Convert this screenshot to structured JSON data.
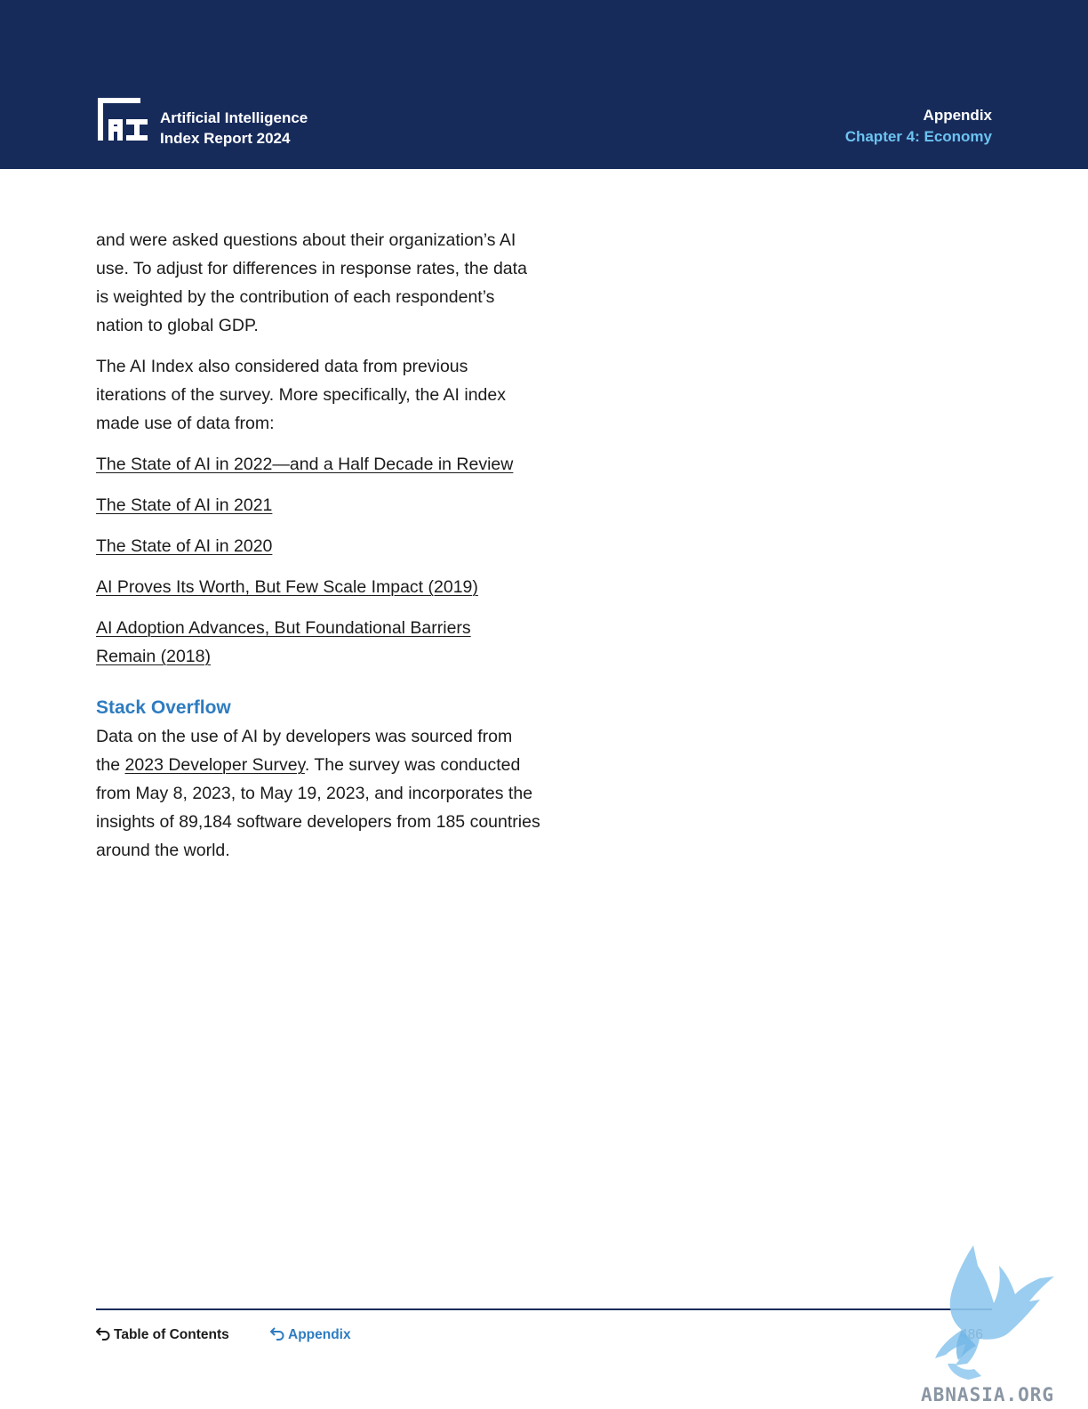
{
  "header": {
    "brand_line1": "Artificial Intelligence",
    "brand_line2": "Index Report 2024",
    "logo_text": "AI",
    "section": "Appendix",
    "chapter": "Chapter 4: Economy"
  },
  "body": {
    "para1": "and were asked questions about their organization’s AI use. To adjust for differences in response rates, the data is weighted by the contribution of each respondent’s nation to global GDP.",
    "para2": "The AI Index also considered data from previous iterations of the survey. More specifically, the AI index made use of data from:",
    "links": [
      "The State of AI in 2022—and a Half Decade in Review",
      "The State of AI in 2021",
      "The State of AI in 2020",
      "AI Proves Its Worth, But Few Scale Impact (2019)",
      "AI Adoption Advances, But Foundational Barriers Remain (2018)"
    ],
    "section_title": "Stack Overflow",
    "para3_before": "Data on the use of AI by developers was sourced from the ",
    "para3_link": "2023 Developer Survey",
    "para3_after": ". The survey was conducted from May 8, 2023, to May 19, 2023, and incorporates the insights of 89,184 software developers from 185 countries around the world."
  },
  "footer": {
    "toc_label": "Table of Contents",
    "appendix_label": "Appendix",
    "page_number": "486",
    "watermark_text": "ABNASIA.ORG"
  },
  "colors": {
    "header_bg": "#172b5b",
    "chapter_accent": "#6cc3f0",
    "section_blue": "#2e7cc0"
  }
}
